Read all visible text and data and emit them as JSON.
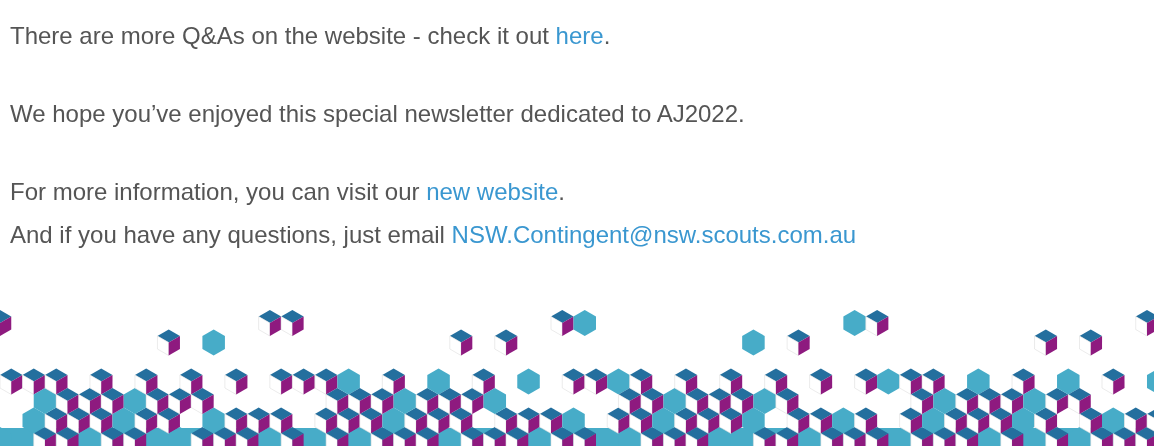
{
  "paragraphs": [
    {
      "lines": [
        [
          {
            "kind": "text",
            "text": "There are more Q&As on the website - check it out "
          },
          {
            "kind": "link",
            "text": "here"
          },
          {
            "kind": "text",
            "text": "."
          }
        ]
      ]
    },
    {
      "lines": [
        [
          {
            "kind": "text",
            "text": "We hope you’ve enjoyed this special newsletter dedicated to AJ2022."
          }
        ]
      ]
    },
    {
      "lines": [
        [
          {
            "kind": "text",
            "text": "For more information, you can visit our "
          },
          {
            "kind": "link",
            "text": "new website"
          },
          {
            "kind": "text",
            "text": "."
          }
        ],
        [
          {
            "kind": "text",
            "text": "And if you have any questions, just email "
          },
          {
            "kind": "link",
            "text": "NSW.Contingent@nsw.scouts.com.au"
          }
        ]
      ]
    }
  ]
}
